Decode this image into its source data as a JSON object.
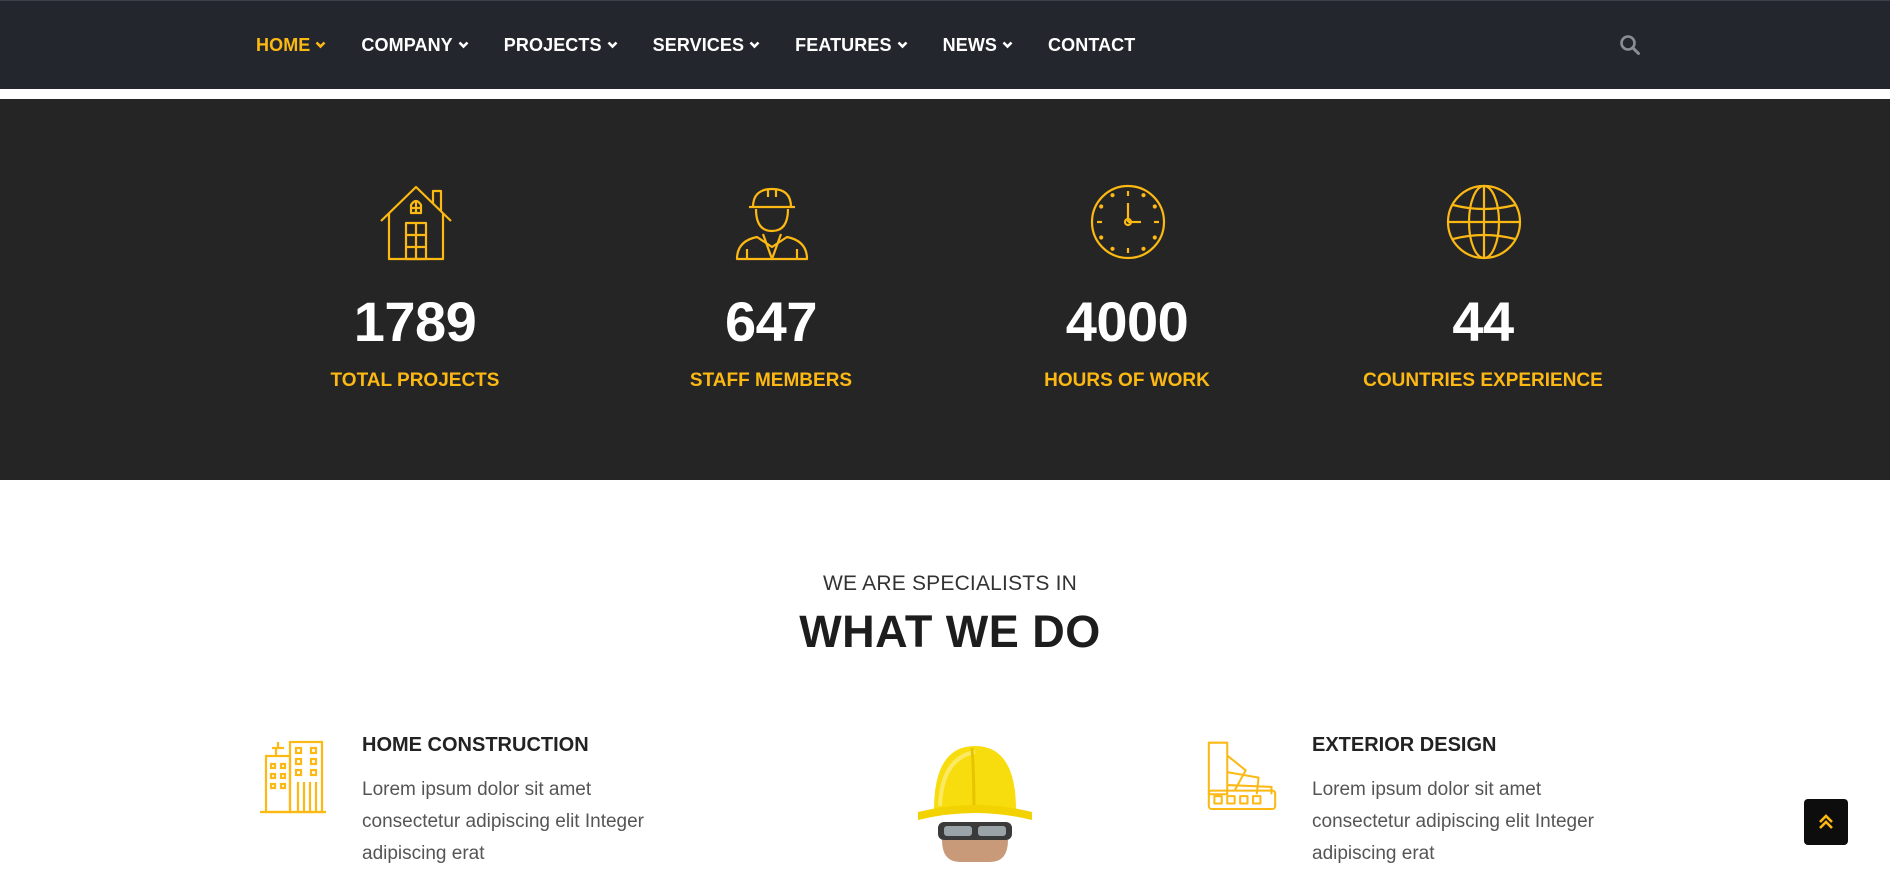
{
  "nav": {
    "items": [
      {
        "label": "HOME",
        "dropdown": true,
        "active": true
      },
      {
        "label": "COMPANY",
        "dropdown": true,
        "active": false
      },
      {
        "label": "PROJECTS",
        "dropdown": true,
        "active": false
      },
      {
        "label": "SERVICES",
        "dropdown": true,
        "active": false
      },
      {
        "label": "FEATURES",
        "dropdown": true,
        "active": false
      },
      {
        "label": "NEWS",
        "dropdown": true,
        "active": false
      },
      {
        "label": "CONTACT",
        "dropdown": false,
        "active": false
      }
    ],
    "search_icon": "search-icon"
  },
  "stats": [
    {
      "icon": "house-icon",
      "number": "1789",
      "label": "TOTAL PROJECTS"
    },
    {
      "icon": "worker-icon",
      "number": "647",
      "label": "STAFF MEMBERS"
    },
    {
      "icon": "clock-icon",
      "number": "4000",
      "label": "HOURS OF WORK"
    },
    {
      "icon": "globe-icon",
      "number": "44",
      "label": "COUNTRIES EXPERIENCE"
    }
  ],
  "what_we_do": {
    "subtitle": "WE ARE SPECIALISTS IN",
    "title": "WHAT WE DO",
    "services": [
      {
        "icon": "buildings-icon",
        "title": "HOME CONSTRUCTION",
        "text": "Lorem ipsum dolor sit amet consectetur adipiscing elit Integer adipiscing erat"
      },
      {
        "icon": "color-swatch-icon",
        "title": "EXTERIOR DESIGN",
        "text": "Lorem ipsum dolor sit amet consectetur adipiscing elit Integer adipiscing erat"
      }
    ]
  },
  "colors": {
    "accent": "#fcb813",
    "navbar_bg": "#23272d",
    "stats_bg": "#252525"
  },
  "scroll_top_icon": "double-chevron-up-icon"
}
